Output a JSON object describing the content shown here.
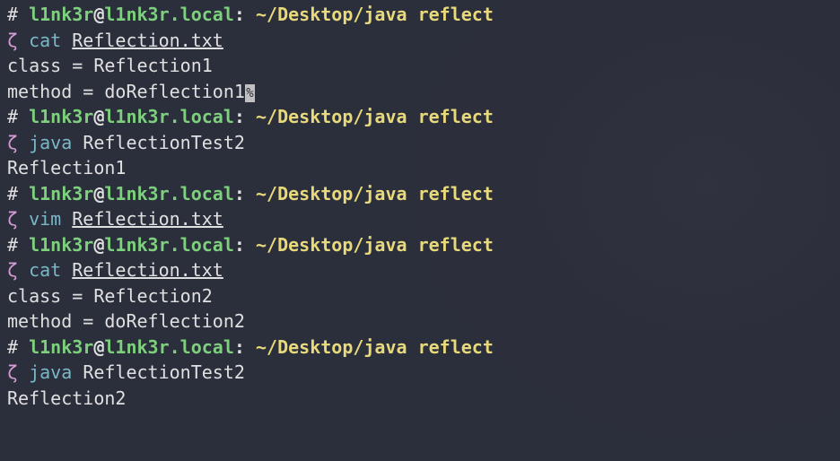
{
  "prompts": [
    {
      "hash": "#",
      "user": "l1nk3r",
      "at": "@",
      "host": "l1nk3r.local",
      "colon": ":",
      "path": "~/Desktop/java reflect",
      "zeta": "ζ",
      "cmd": "cat",
      "arg": "Reflection.txt",
      "arg_underlined": true,
      "output": [
        "class = Reflection1",
        "method = doReflection1"
      ],
      "has_cursor": true
    },
    {
      "hash": "#",
      "user": "l1nk3r",
      "at": "@",
      "host": "l1nk3r.local",
      "colon": ":",
      "path": "~/Desktop/java reflect",
      "zeta": "ζ",
      "cmd": "java",
      "arg": "ReflectionTest2",
      "arg_underlined": false,
      "output": [
        "Reflection1"
      ]
    },
    {
      "hash": "#",
      "user": "l1nk3r",
      "at": "@",
      "host": "l1nk3r.local",
      "colon": ":",
      "path": "~/Desktop/java reflect",
      "zeta": "ζ",
      "cmd": "vim",
      "arg": "Reflection.txt",
      "arg_underlined": true,
      "output": []
    },
    {
      "hash": "#",
      "user": "l1nk3r",
      "at": "@",
      "host": "l1nk3r.local",
      "colon": ":",
      "path": "~/Desktop/java reflect",
      "zeta": "ζ",
      "cmd": "cat",
      "arg": "Reflection.txt",
      "arg_underlined": true,
      "output": [
        "class = Reflection2",
        "method = doReflection2"
      ]
    },
    {
      "hash": "#",
      "user": "l1nk3r",
      "at": "@",
      "host": "l1nk3r.local",
      "colon": ":",
      "path": "~/Desktop/java reflect",
      "zeta": "ζ",
      "cmd": "java",
      "arg": "ReflectionTest2",
      "arg_underlined": false,
      "output": [
        "Reflection2"
      ]
    }
  ]
}
